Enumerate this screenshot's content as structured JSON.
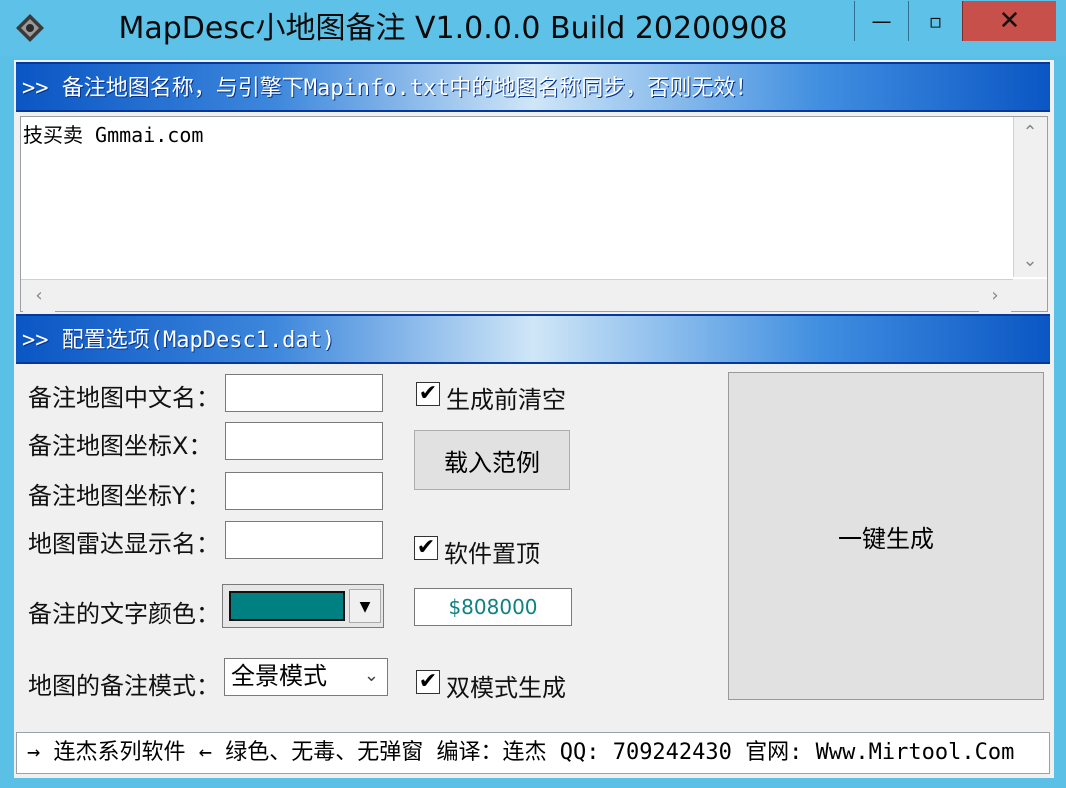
{
  "window": {
    "title": "MapDesc小地图备注 V1.0.0.0 Build 20200908",
    "min_glyph": "—",
    "max_glyph": "▫",
    "close_glyph": "✕"
  },
  "banner1": {
    "text": ">> 备注地图名称，与引擎下Mapinfo.txt中的地图名称同步，否则无效！"
  },
  "memo": {
    "content": "技买卖 Gmmai.com"
  },
  "banner2": {
    "text": ">> 配置选项(MapDesc1.dat)"
  },
  "form": {
    "cn_name_label": "备注地图中文名：",
    "coord_x_label": "备注地图坐标X：",
    "coord_y_label": "备注地图坐标Y：",
    "radar_label": "地图雷达显示名：",
    "color_label": "备注的文字颜色：",
    "mode_label": "地图的备注模式：",
    "color_value": "$808000",
    "mode_value": "全景模式",
    "text_color_swatch": "#008080"
  },
  "options": {
    "clear_before": "生成前清空",
    "load_example": "载入范例",
    "stay_on_top": "软件置顶",
    "dual_mode": "双模式生成",
    "generate": "一键生成",
    "check_glyph": "✔"
  },
  "statusbar": {
    "text": "→ 连杰系列软件 ← 绿色、无毒、无弹窗 编译：连杰 QQ: 709242430 官网: Www.Mirtool.Com"
  }
}
